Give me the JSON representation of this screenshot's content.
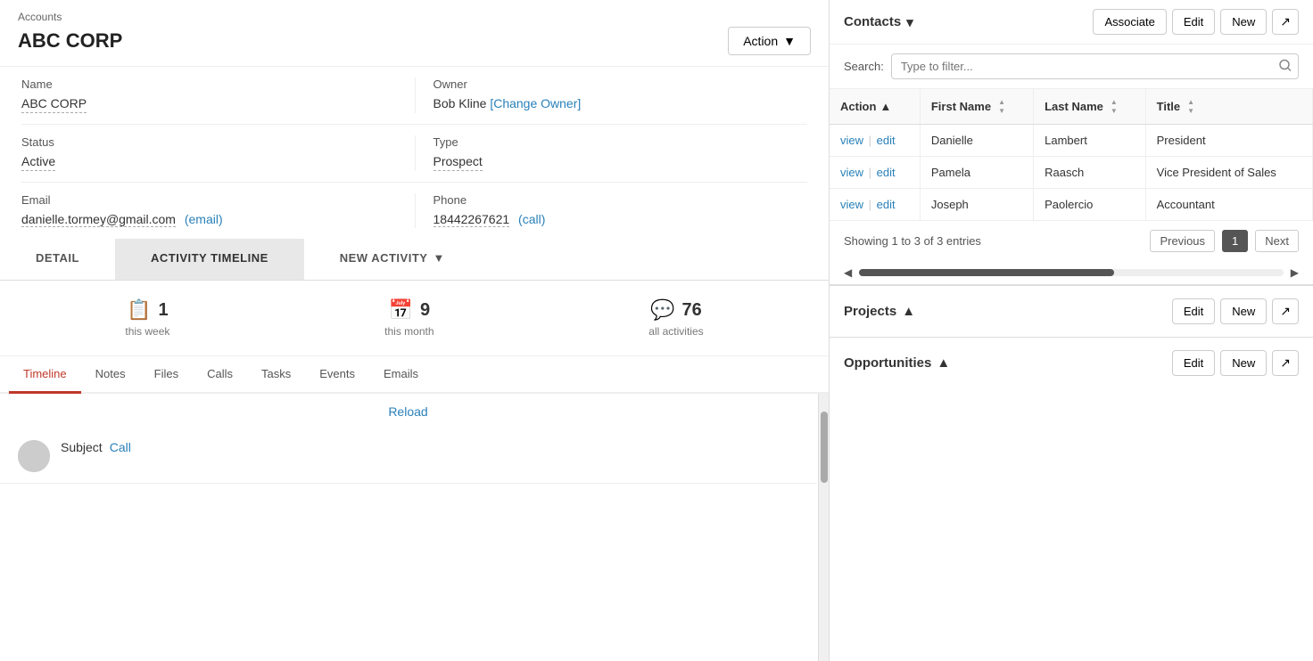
{
  "breadcrumb": "Accounts",
  "pageTitle": "ABC CORP",
  "actionButton": "Action",
  "fields": {
    "name": {
      "label": "Name",
      "value": "ABC CORP"
    },
    "owner": {
      "label": "Owner",
      "value": "Bob Kline",
      "changeLabel": "[Change Owner]"
    },
    "status": {
      "label": "Status",
      "value": "Active"
    },
    "type": {
      "label": "Type",
      "value": "Prospect"
    },
    "email": {
      "label": "Email",
      "value": "danielle.tormey@gmail.com",
      "emailLabel": "(email)"
    },
    "phone": {
      "label": "Phone",
      "value": "18442267621",
      "callLabel": "(call)"
    }
  },
  "tabs": [
    {
      "id": "detail",
      "label": "DETAIL"
    },
    {
      "id": "activity-timeline",
      "label": "ACTIVITY TIMELINE"
    },
    {
      "id": "new-activity",
      "label": "NEW ACTIVITY"
    }
  ],
  "stats": [
    {
      "icon": "📋",
      "number": "1",
      "label": "this week"
    },
    {
      "icon": "📅",
      "number": "9",
      "label": "this month"
    },
    {
      "icon": "💬",
      "number": "76",
      "label": "all activities"
    }
  ],
  "subTabs": [
    "Timeline",
    "Notes",
    "Files",
    "Calls",
    "Tasks",
    "Events",
    "Emails"
  ],
  "activeSubTab": "Timeline",
  "reloadLabel": "Reload",
  "activityItem": {
    "subject": "Subject",
    "type": "Call"
  },
  "contacts": {
    "sectionTitle": "Contacts",
    "searchPlaceholder": "Type to filter...",
    "searchLabel": "Search:",
    "buttons": {
      "associate": "Associate",
      "edit": "Edit",
      "new": "New"
    },
    "columns": [
      {
        "key": "action",
        "label": "Action",
        "sortable": true
      },
      {
        "key": "firstName",
        "label": "First Name",
        "sortable": true
      },
      {
        "key": "lastName",
        "label": "Last Name",
        "sortable": true
      },
      {
        "key": "title",
        "label": "Title",
        "sortable": true
      }
    ],
    "rows": [
      {
        "firstName": "Danielle",
        "lastName": "Lambert",
        "title": "President"
      },
      {
        "firstName": "Pamela",
        "lastName": "Raasch",
        "title": "Vice President of Sales"
      },
      {
        "firstName": "Joseph",
        "lastName": "Paolercio",
        "title": "Accountant"
      }
    ],
    "pagination": {
      "showing": "Showing 1 to 3 of 3 entries",
      "previousLabel": "Previous",
      "nextLabel": "Next",
      "currentPage": "1"
    }
  },
  "projects": {
    "sectionTitle": "Projects",
    "editLabel": "Edit",
    "newLabel": "New"
  },
  "opportunities": {
    "sectionTitle": "Opportunities",
    "editLabel": "Edit",
    "newLabel": "New"
  }
}
